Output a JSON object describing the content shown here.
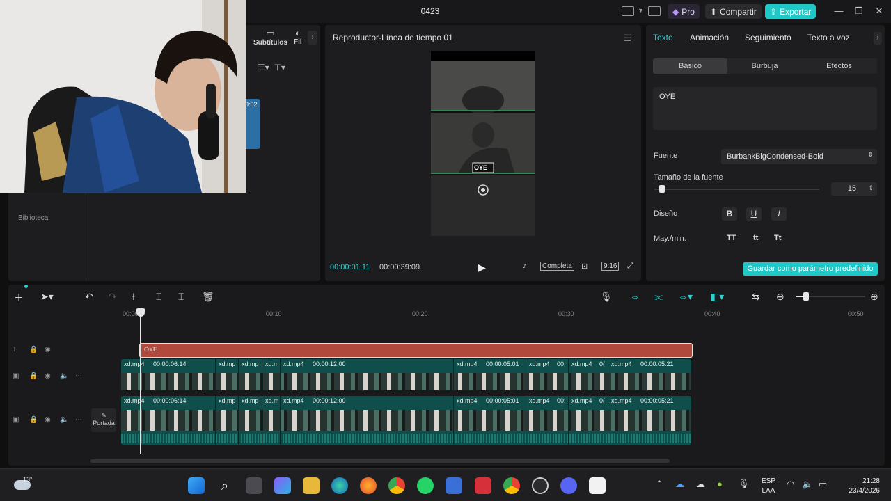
{
  "window": {
    "title": "0423",
    "pro_label": "Pro",
    "share_label": "Compartir",
    "export_label": "Exportar"
  },
  "media": {
    "tabs": [
      "Subtítulos",
      "Fil"
    ],
    "library_label": "Biblioteca",
    "thumb_time": "0:02"
  },
  "player": {
    "title": "Reproductor-Línea de tiempo 01",
    "current_time": "00:00:01:11",
    "total_time": "00:00:39:09",
    "full_label": "Completa",
    "ratio_label": "9:16",
    "overlay_text": "OYE"
  },
  "props": {
    "tabs": [
      "Texto",
      "Animación",
      "Seguimiento",
      "Texto a voz"
    ],
    "segments": [
      "Básico",
      "Burbuja",
      "Efectos"
    ],
    "text_value": "OYE",
    "font_label": "Fuente",
    "font_value": "BurbankBigCondensed-Bold",
    "size_label": "Tamaño de la fuente",
    "size_value": "15",
    "size_fraction": 0.04,
    "design_label": "Diseño",
    "case_label": "May./min.",
    "case_options": [
      "TT",
      "tt",
      "Tt"
    ],
    "save_label": "Guardar como parámetro predefinido"
  },
  "timeline": {
    "ruler": [
      "00:00",
      "00:10",
      "00:20",
      "00:30",
      "00:40",
      "00:50"
    ],
    "text_clip_label": "OYE",
    "cover_label": "Portada",
    "clips": [
      {
        "name": "xd.mp4",
        "duration": "00:00:06:14"
      },
      {
        "name": "xd.mp",
        "duration": ""
      },
      {
        "name": "xd.mp",
        "duration": ""
      },
      {
        "name": "xd.m",
        "duration": ""
      },
      {
        "name": "xd.mp4",
        "duration": "00:00:12:00"
      },
      {
        "name": "xd.mp4",
        "duration": "00:00:05:01"
      },
      {
        "name": "xd.mp4",
        "duration": "00:"
      },
      {
        "name": "xd.mp4",
        "duration": "0("
      },
      {
        "name": "xd.mp4",
        "duration": "00:00:05:21"
      }
    ],
    "zoom_fraction": 0.15
  },
  "taskbar": {
    "temperature": "13°",
    "language": "ESP",
    "language_sub": "LAA",
    "time": "21:28",
    "date": "23/4/2026"
  },
  "colors": {
    "accent": "#1fc7c7",
    "text_clip": "#b14a3d",
    "video_track": "#0f4e4a"
  }
}
